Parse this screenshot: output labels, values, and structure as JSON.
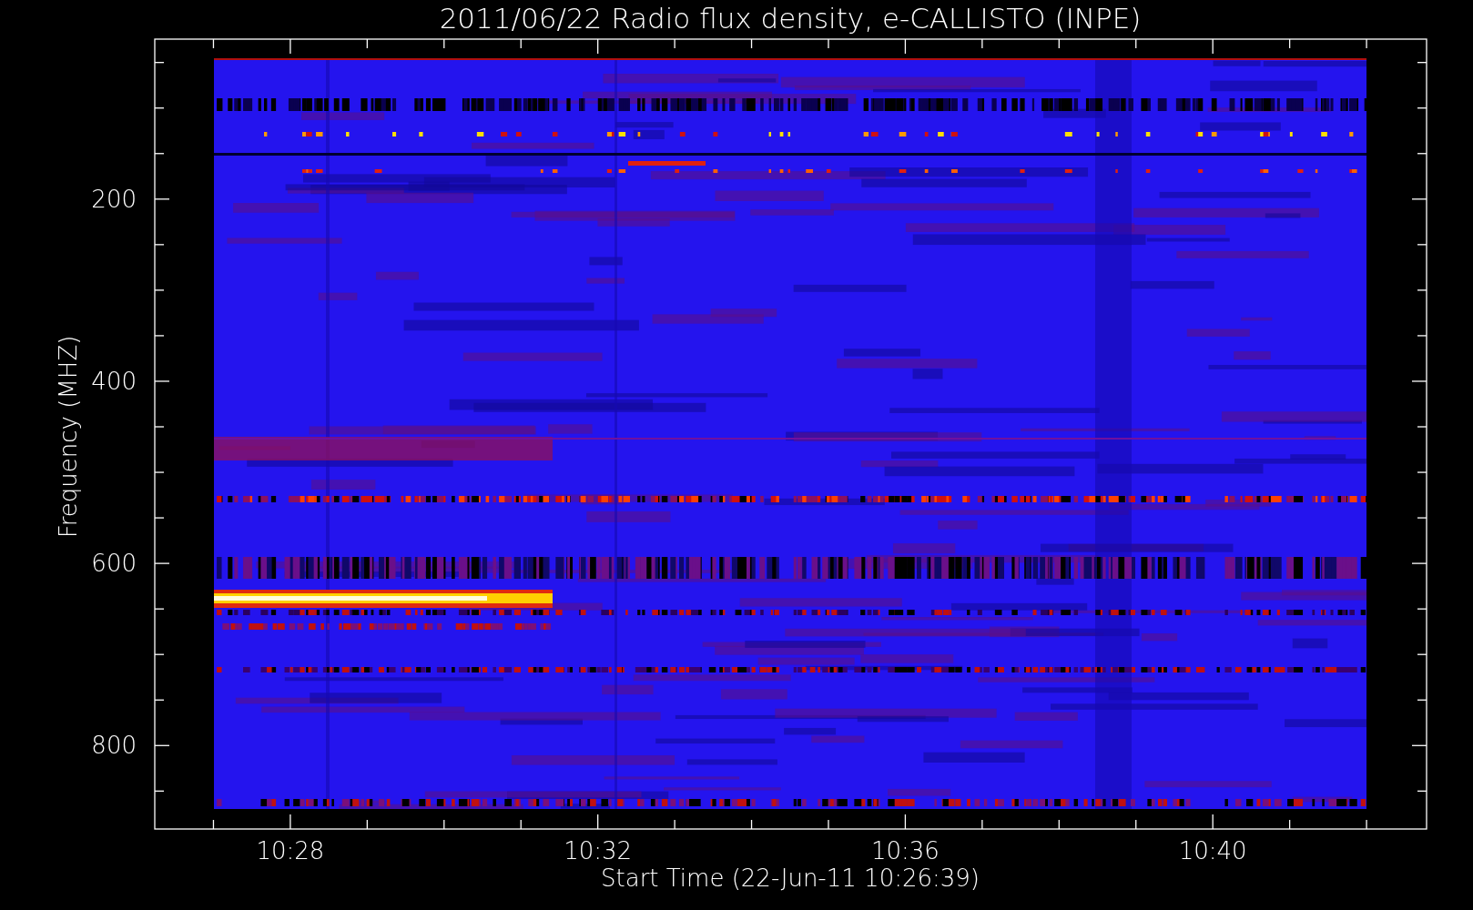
{
  "plot": {
    "title": "2011/06/22  Radio flux density, e-CALLISTO (INPE)",
    "ylabel": "Frequency (MHZ)",
    "xlabel": "Start Time (22-Jun-11 10:26:39)",
    "yticks": [
      "200",
      "400",
      "600",
      "800"
    ],
    "xticks": [
      "10:28",
      "10:32",
      "10:36",
      "10:40"
    ]
  }
}
